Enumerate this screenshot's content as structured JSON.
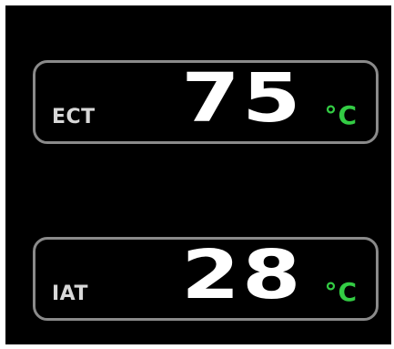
{
  "gauges": [
    {
      "label": "ECT",
      "value": "75",
      "unit": "°C"
    },
    {
      "label": "IAT",
      "value": "28",
      "unit": "°C"
    }
  ],
  "colors": {
    "background": "#000000",
    "frame": "#8a8a8a",
    "label": "#d8d8d8",
    "value": "#ffffff",
    "unit": "#33cc44"
  }
}
